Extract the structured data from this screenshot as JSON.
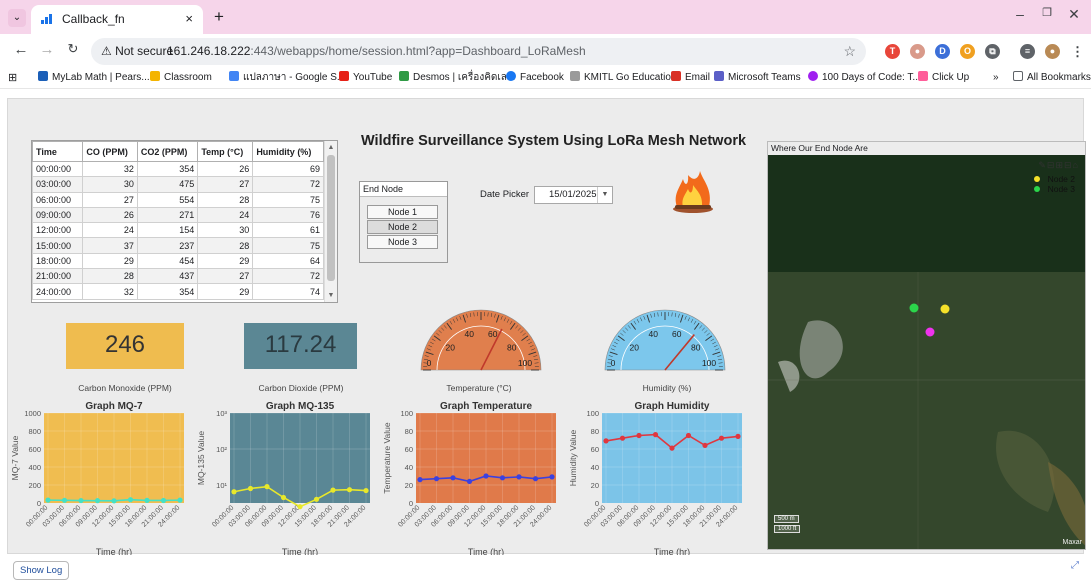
{
  "browser": {
    "tab_title": "Callback_fn",
    "tab_close": "×",
    "new_tab": "+",
    "not_secure": "⚠ Not secure",
    "url_host": "161.246.18.222",
    "url_rest": ":443/webapps/home/session.html?app=Dashboard_LoRaMesh",
    "bookmarks": [
      "MyLab Math | Pears...",
      "Classroom",
      "แปลภาษา - Google S...",
      "YouTube",
      "Desmos | เครื่องคิดเล...",
      "Facebook",
      "KMITL Go Education",
      "Email",
      "Microsoft Teams",
      "100 Days of Code: T...",
      "Click Up",
      "»",
      "All Bookmarks"
    ]
  },
  "dashboard": {
    "title": "Wildfire Surveillance System Using LoRa Mesh Network",
    "table": {
      "headers": [
        "Time",
        "CO (PPM)",
        "CO2 (PPM)",
        "Temp (°C)",
        "Humidity (%)"
      ],
      "rows": [
        [
          "00:00:00",
          "32",
          "354",
          "26",
          "69"
        ],
        [
          "03:00:00",
          "30",
          "475",
          "27",
          "72"
        ],
        [
          "06:00:00",
          "27",
          "554",
          "28",
          "75"
        ],
        [
          "09:00:00",
          "26",
          "271",
          "24",
          "76"
        ],
        [
          "12:00:00",
          "24",
          "154",
          "30",
          "61"
        ],
        [
          "15:00:00",
          "37",
          "237",
          "28",
          "75"
        ],
        [
          "18:00:00",
          "29",
          "454",
          "29",
          "64"
        ],
        [
          "21:00:00",
          "28",
          "437",
          "27",
          "72"
        ],
        [
          "24:00:00",
          "32",
          "354",
          "29",
          "74"
        ]
      ]
    },
    "end_node": {
      "label": "End Node",
      "options": [
        "Node 1",
        "Node 2",
        "Node 3"
      ],
      "selected": "Node 2"
    },
    "date_picker": {
      "label": "Date Picker",
      "value": "15/01/2025"
    },
    "co_tile": {
      "value": "246",
      "caption": "Carbon Monoxide (PPM)",
      "color": "#efbc4f"
    },
    "co2_tile": {
      "value": "117.24",
      "caption": "Carbon Dioxide (PPM)",
      "color": "#5b8794"
    },
    "temp_gauge": {
      "value": 65,
      "caption": "Temperature (°C)",
      "ticks": [
        "0",
        "20",
        "40",
        "60",
        "80",
        "100"
      ],
      "color": "#e07f4d"
    },
    "hum_gauge": {
      "value": 72,
      "caption": "Humidity (%)",
      "ticks": [
        "0",
        "20",
        "40",
        "60",
        "80",
        "100"
      ],
      "color": "#7cc7ec"
    },
    "map": {
      "title": "Where Our End Node Are",
      "legend": [
        {
          "name": "Node 2",
          "color": "#f5e12a"
        },
        {
          "name": "Node 3",
          "color": "#2bd64b"
        }
      ],
      "scale_top": "500 m",
      "scale_bottom": "1000 ft",
      "attribution": "Maxar"
    },
    "show_log": "Show Log"
  },
  "chart_data": [
    {
      "type": "bar",
      "title": "Graph MQ-7",
      "xlabel": "Time (hr)",
      "ylabel": "MQ-7 Value",
      "ylim": [
        0,
        1000
      ],
      "yticks": [
        "0",
        "200",
        "400",
        "600",
        "800",
        "1000"
      ],
      "categories": [
        "00:00:00",
        "03:00:00",
        "06:00:00",
        "09:00:00",
        "12:00:00",
        "15:00:00",
        "18:00:00",
        "21:00:00",
        "24:00:00"
      ],
      "values": [
        1000,
        1000,
        1000,
        1000,
        1000,
        1000,
        1000,
        1000,
        1000
      ],
      "line": [
        32,
        30,
        27,
        26,
        24,
        37,
        29,
        28,
        32
      ],
      "fill": "#f0bd50",
      "line_color": "#45e0c4"
    },
    {
      "type": "line",
      "title": "Graph MQ-135",
      "xlabel": "Time (hr)",
      "ylabel": "MQ-135 Value",
      "yscale": "log",
      "yticks": [
        "10¹",
        "10²",
        "10³"
      ],
      "categories": [
        "00:00:00",
        "03:00:00",
        "06:00:00",
        "09:00:00",
        "12:00:00",
        "15:00:00",
        "18:00:00",
        "21:00:00",
        "24:00:00"
      ],
      "values": [
        6.5,
        8,
        9,
        4.5,
        2.5,
        4,
        7.2,
        7.4,
        7
      ],
      "fill": "#5a8795",
      "line_color": "#e8e82a"
    },
    {
      "type": "line",
      "title": "Graph Temperature",
      "xlabel": "Time (hr)",
      "ylabel": "Temperature Value",
      "ylim": [
        0,
        100
      ],
      "yticks": [
        "0",
        "20",
        "40",
        "60",
        "80",
        "100"
      ],
      "categories": [
        "00:00:00",
        "03:00:00",
        "06:00:00",
        "09:00:00",
        "12:00:00",
        "15:00:00",
        "18:00:00",
        "21:00:00",
        "24:00:00"
      ],
      "values": [
        26,
        27,
        28,
        24,
        30,
        28,
        29,
        27,
        29
      ],
      "fill": "#e07a4a",
      "line_color": "#3b41e0"
    },
    {
      "type": "line",
      "title": "Graph Humidity",
      "xlabel": "Time (hr)",
      "ylabel": "Humidity Value",
      "ylim": [
        0,
        100
      ],
      "yticks": [
        "0",
        "20",
        "40",
        "60",
        "80",
        "100"
      ],
      "categories": [
        "00:00:00",
        "03:00:00",
        "06:00:00",
        "09:00:00",
        "12:00:00",
        "15:00:00",
        "18:00:00",
        "21:00:00",
        "24:00:00"
      ],
      "values": [
        69,
        72,
        75,
        76,
        61,
        75,
        64,
        72,
        74
      ],
      "fill": "#7cc4e8",
      "line_color": "#e0373f"
    }
  ]
}
